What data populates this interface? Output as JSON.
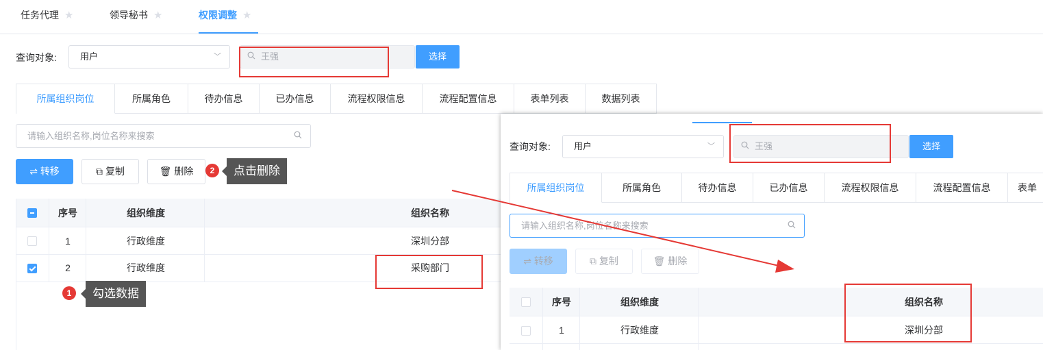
{
  "top_tabs": [
    {
      "label": "任务代理"
    },
    {
      "label": "领导秘书"
    },
    {
      "label": "权限调整"
    }
  ],
  "query": {
    "label": "查询对象:",
    "select_value": "用户",
    "search_value": "王强",
    "select_button": "选择"
  },
  "tabs": [
    "所属组织岗位",
    "所属角色",
    "待办信息",
    "已办信息",
    "流程权限信息",
    "流程配置信息",
    "表单列表",
    "数据列表"
  ],
  "overlay_tabs": [
    "所属组织岗位",
    "所属角色",
    "待办信息",
    "已办信息",
    "流程权限信息",
    "流程配置信息",
    "表单"
  ],
  "filter": {
    "placeholder": "请输入组织名称,岗位名称来搜索"
  },
  "actions": {
    "transfer": "转移",
    "copy": "复制",
    "delete": "删除"
  },
  "table": {
    "columns": [
      "序号",
      "组织维度",
      "组织名称"
    ],
    "rows": [
      {
        "no": "1",
        "dimension": "行政维度",
        "name": "深圳分部",
        "checked": false
      },
      {
        "no": "2",
        "dimension": "行政维度",
        "name": "采购部门",
        "checked": true
      }
    ]
  },
  "overlay_table": {
    "columns": [
      "序号",
      "组织维度",
      "组织名称"
    ],
    "rows": [
      {
        "no": "1",
        "dimension": "行政维度",
        "name": "深圳分部"
      }
    ]
  },
  "annotations": {
    "step1_number": "1",
    "step1_text": "勾选数据",
    "step2_number": "2",
    "step2_text": "点击删除"
  },
  "colors": {
    "accent": "#409eff",
    "highlight": "#e53935",
    "tip_bg": "#555555"
  },
  "icons": {
    "star": "star-icon",
    "search": "search-icon",
    "chevron": "chevron-down-icon",
    "transfer": "swap-icon",
    "copy": "copy-icon",
    "delete": "trash-icon"
  }
}
